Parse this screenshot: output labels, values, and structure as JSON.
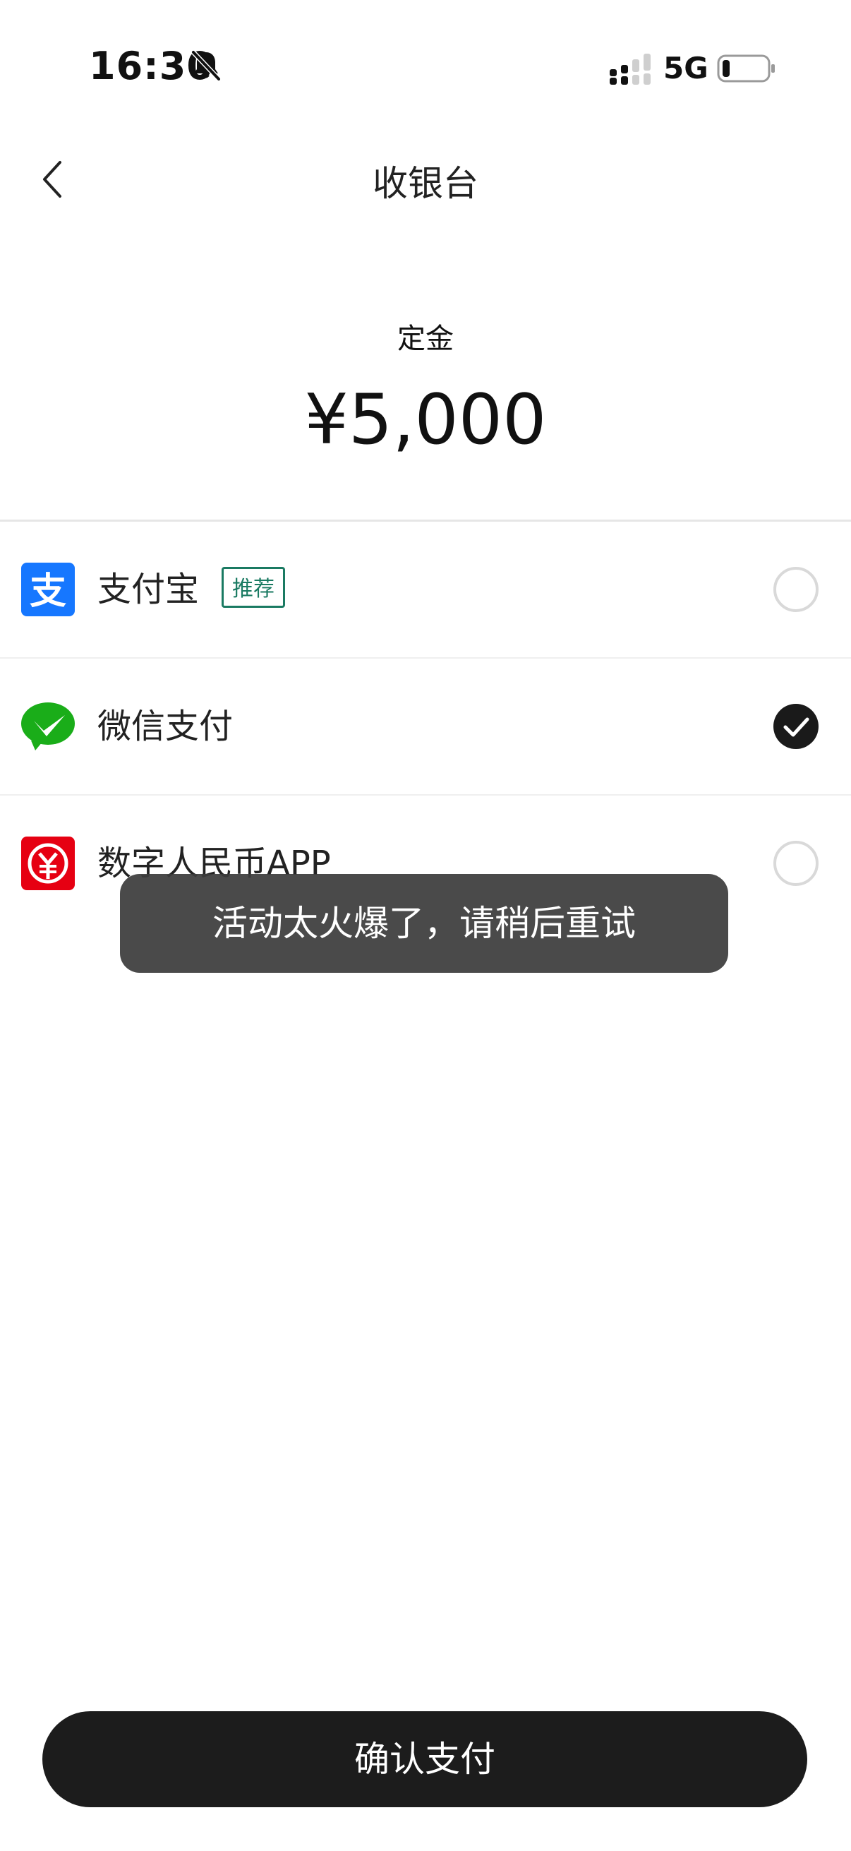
{
  "status_bar": {
    "time": "16:30",
    "network": "5G"
  },
  "nav": {
    "title": "收银台"
  },
  "order": {
    "amount_label": "定金",
    "amount": "¥5,000"
  },
  "payment_methods": [
    {
      "label": "支付宝",
      "badge": "推荐",
      "selected": false,
      "icon": "alipay-icon",
      "icon_color": "#1677ff"
    },
    {
      "label": "微信支付",
      "selected": true,
      "icon": "wechat-pay-icon",
      "icon_color": "#1aad19"
    },
    {
      "label": "数字人民币APP",
      "selected": false,
      "icon": "digital-rmb-icon",
      "icon_color": "#e60012"
    }
  ],
  "toast": {
    "message": "活动太火爆了，请稍后重试"
  },
  "footer": {
    "confirm_label": "确认支付"
  },
  "colors": {
    "badge_green": "#1a7a62",
    "button_dark": "#1c1c1c"
  }
}
